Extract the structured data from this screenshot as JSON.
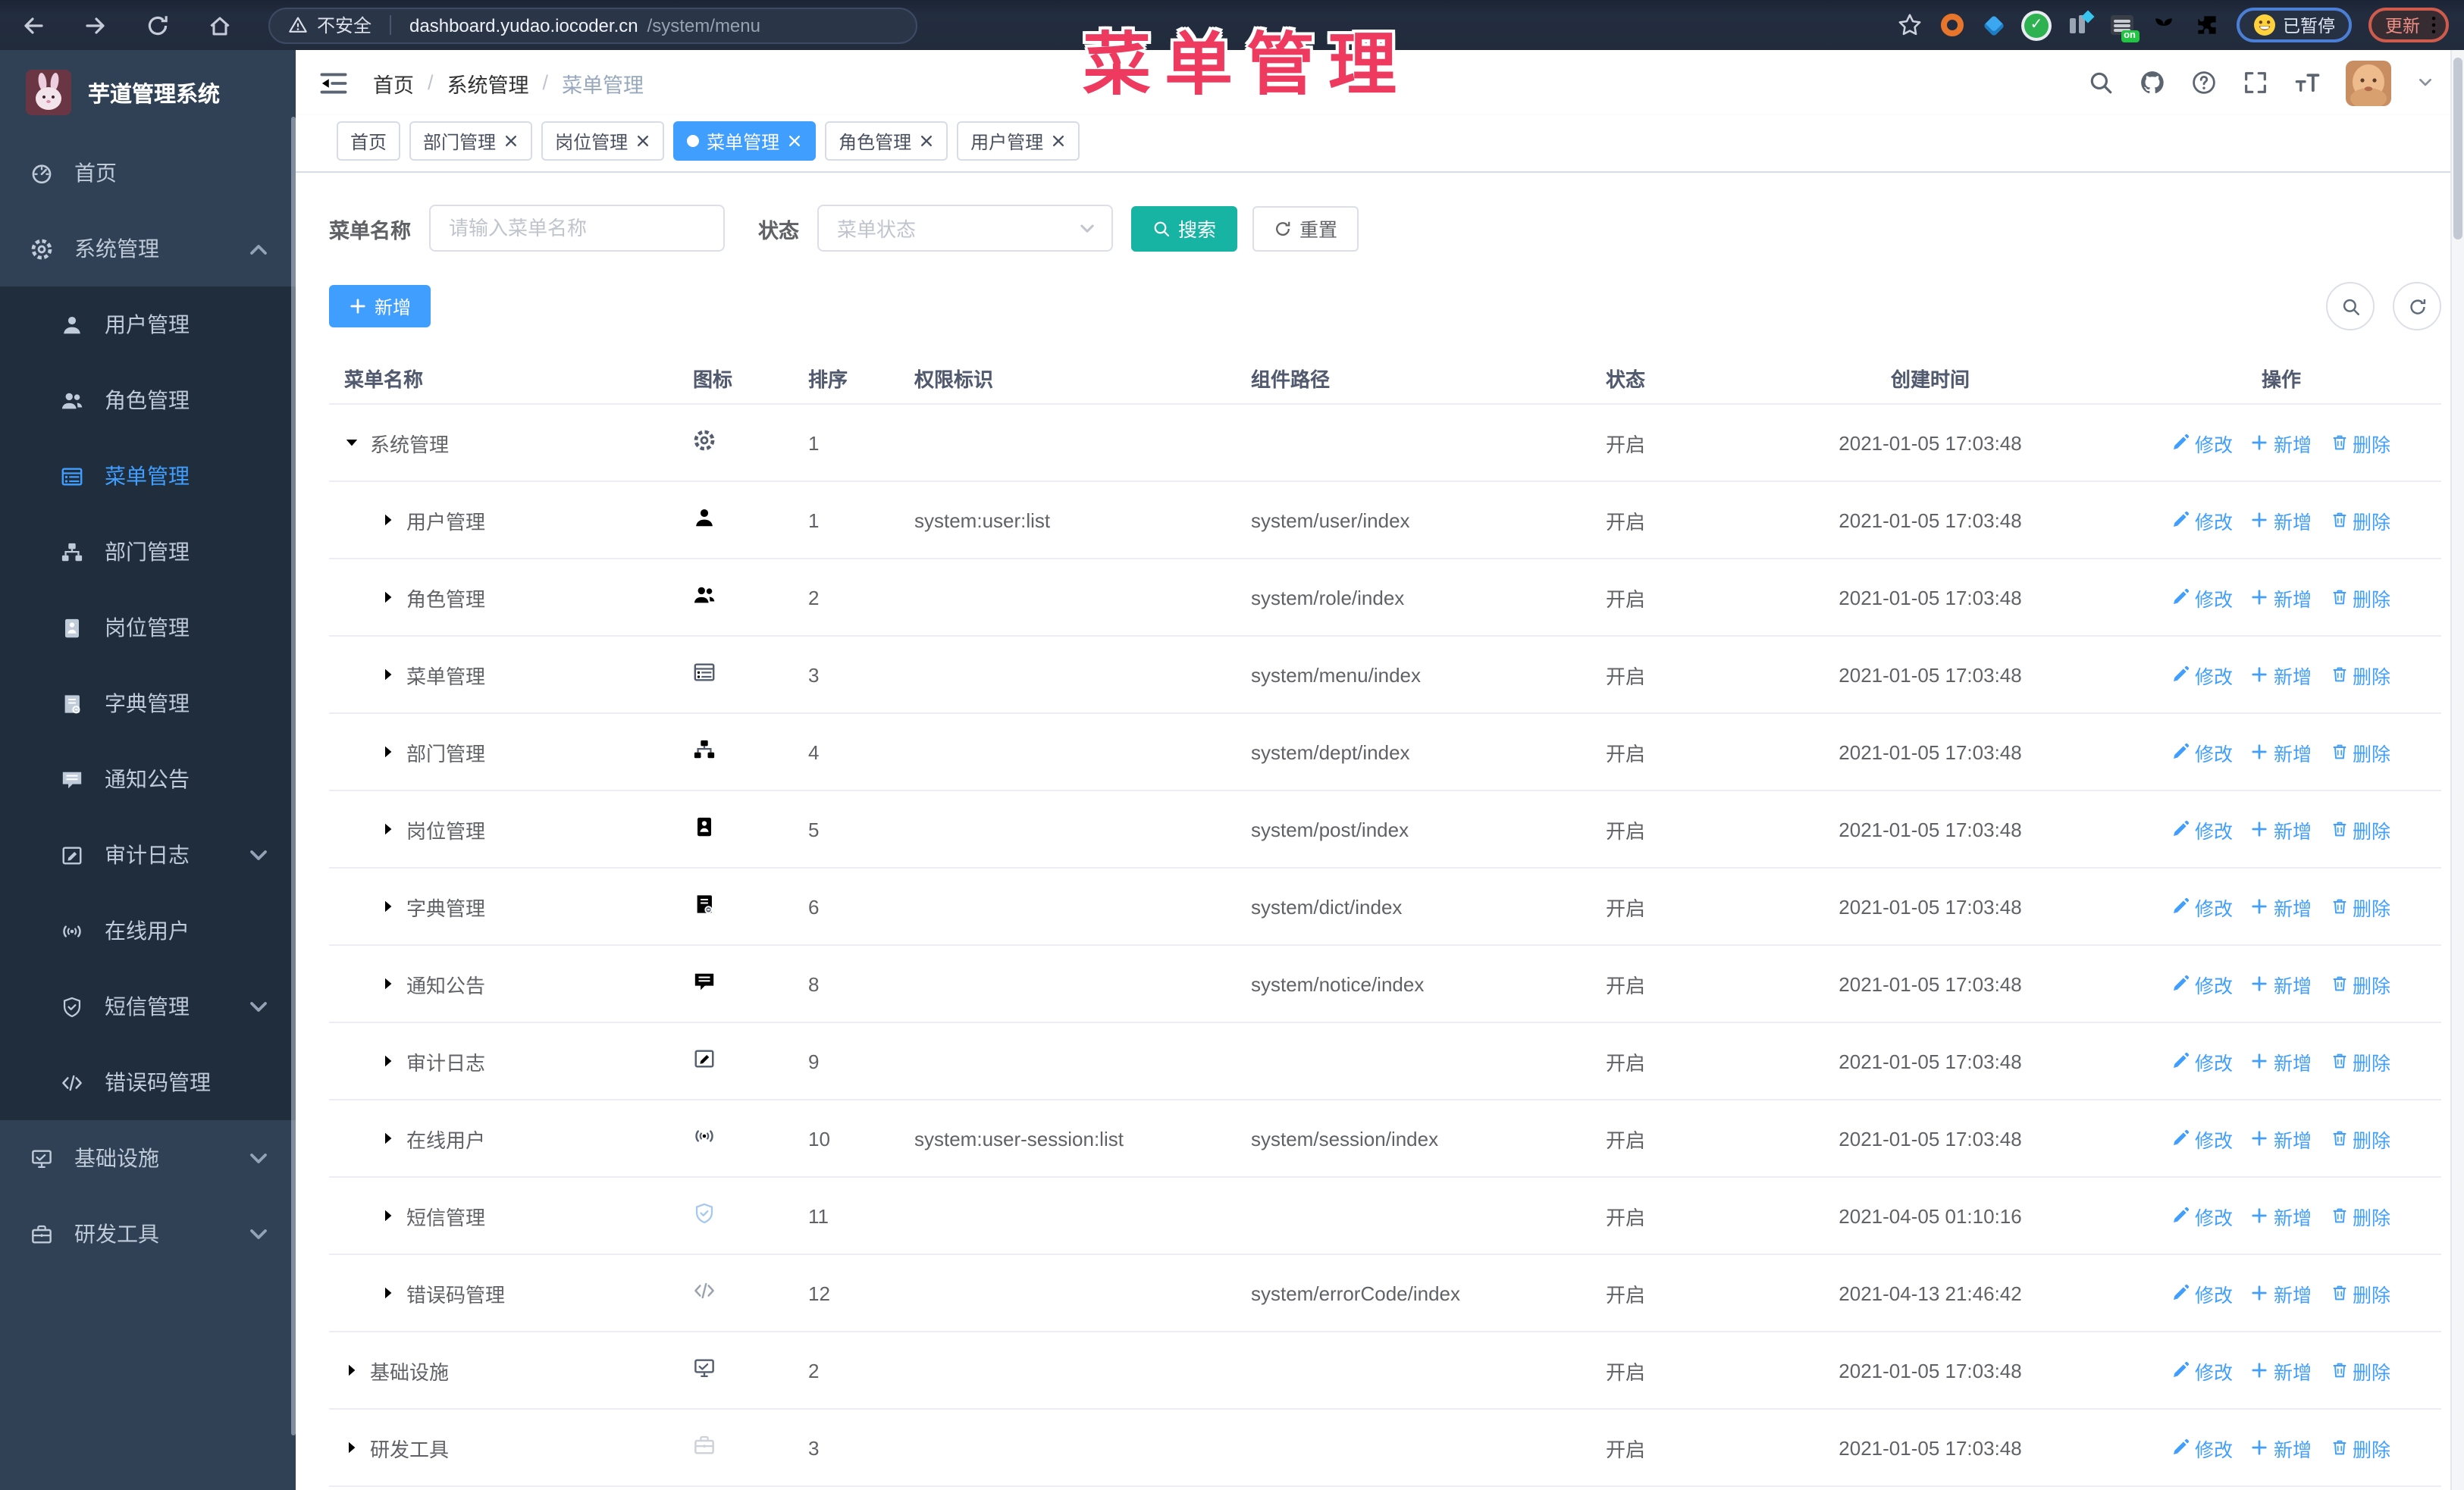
{
  "browser": {
    "security_label": "不安全",
    "url_host": "dashboard.yudao.iocoder.cn",
    "url_path": "/system/menu",
    "paused_badge": "已暂停",
    "update_button": "更新"
  },
  "overlay_title": "菜单管理",
  "header": {
    "breadcrumb": [
      "首页",
      "系统管理",
      "菜单管理"
    ]
  },
  "tabs": [
    {
      "label": "首页",
      "closable": false,
      "active": false
    },
    {
      "label": "部门管理",
      "closable": true,
      "active": false
    },
    {
      "label": "岗位管理",
      "closable": true,
      "active": false
    },
    {
      "label": "菜单管理",
      "closable": true,
      "active": true
    },
    {
      "label": "角色管理",
      "closable": true,
      "active": false
    },
    {
      "label": "用户管理",
      "closable": true,
      "active": false
    }
  ],
  "sidebar": {
    "logo_title": "芋道管理系统",
    "items": [
      {
        "label": "首页",
        "icon": "dash",
        "level": "top"
      },
      {
        "label": "系统管理",
        "icon": "gear",
        "level": "top",
        "arrow": "up",
        "open": true
      },
      {
        "label": "用户管理",
        "icon": "user",
        "level": "sub"
      },
      {
        "label": "角色管理",
        "icon": "users",
        "level": "sub"
      },
      {
        "label": "菜单管理",
        "icon": "menu",
        "level": "sub",
        "active": true
      },
      {
        "label": "部门管理",
        "icon": "tree",
        "level": "sub"
      },
      {
        "label": "岗位管理",
        "icon": "post",
        "level": "sub"
      },
      {
        "label": "字典管理",
        "icon": "dict",
        "level": "sub"
      },
      {
        "label": "通知公告",
        "icon": "msg",
        "level": "sub"
      },
      {
        "label": "审计日志",
        "icon": "form",
        "level": "sub",
        "arrow": "down"
      },
      {
        "label": "在线用户",
        "icon": "online",
        "level": "sub"
      },
      {
        "label": "短信管理",
        "icon": "shield",
        "level": "sub",
        "arrow": "down"
      },
      {
        "label": "错误码管理",
        "icon": "code",
        "level": "sub"
      },
      {
        "label": "基础设施",
        "icon": "monitor",
        "level": "top",
        "arrow": "down"
      },
      {
        "label": "研发工具",
        "icon": "tool",
        "level": "top",
        "arrow": "down"
      }
    ]
  },
  "filter": {
    "name_label": "菜单名称",
    "name_placeholder": "请输入菜单名称",
    "status_label": "状态",
    "status_placeholder": "菜单状态",
    "search_label": "搜索",
    "reset_label": "重置"
  },
  "toolbar": {
    "add_label": "新增"
  },
  "table": {
    "columns": [
      "菜单名称",
      "图标",
      "排序",
      "权限标识",
      "组件路径",
      "状态",
      "创建时间",
      "操作"
    ],
    "rows": [
      {
        "name": "系统管理",
        "icon": "gear",
        "sort": "1",
        "perm": "",
        "path": "",
        "status": "开启",
        "time": "2021-01-05 17:03:48",
        "level": 0,
        "expanded": true
      },
      {
        "name": "用户管理",
        "icon": "user",
        "sort": "1",
        "perm": "system:user:list",
        "path": "system/user/index",
        "status": "开启",
        "time": "2021-01-05 17:03:48",
        "level": 1
      },
      {
        "name": "角色管理",
        "icon": "users",
        "sort": "2",
        "perm": "",
        "path": "system/role/index",
        "status": "开启",
        "time": "2021-01-05 17:03:48",
        "level": 1
      },
      {
        "name": "菜单管理",
        "icon": "menu",
        "sort": "3",
        "perm": "",
        "path": "system/menu/index",
        "status": "开启",
        "time": "2021-01-05 17:03:48",
        "level": 1
      },
      {
        "name": "部门管理",
        "icon": "tree",
        "sort": "4",
        "perm": "",
        "path": "system/dept/index",
        "status": "开启",
        "time": "2021-01-05 17:03:48",
        "level": 1
      },
      {
        "name": "岗位管理",
        "icon": "post",
        "sort": "5",
        "perm": "",
        "path": "system/post/index",
        "status": "开启",
        "time": "2021-01-05 17:03:48",
        "level": 1
      },
      {
        "name": "字典管理",
        "icon": "dict",
        "sort": "6",
        "perm": "",
        "path": "system/dict/index",
        "status": "开启",
        "time": "2021-01-05 17:03:48",
        "level": 1
      },
      {
        "name": "通知公告",
        "icon": "msg",
        "sort": "8",
        "perm": "",
        "path": "system/notice/index",
        "status": "开启",
        "time": "2021-01-05 17:03:48",
        "level": 1
      },
      {
        "name": "审计日志",
        "icon": "form",
        "sort": "9",
        "perm": "",
        "path": "",
        "status": "开启",
        "time": "2021-01-05 17:03:48",
        "level": 1
      },
      {
        "name": "在线用户",
        "icon": "online",
        "sort": "10",
        "perm": "system:user-session:list",
        "path": "system/session/index",
        "status": "开启",
        "time": "2021-01-05 17:03:48",
        "level": 1
      },
      {
        "name": "短信管理",
        "icon": "shield",
        "sort": "11",
        "perm": "",
        "path": "",
        "status": "开启",
        "time": "2021-04-05 01:10:16",
        "level": 1
      },
      {
        "name": "错误码管理",
        "icon": "code",
        "sort": "12",
        "perm": "",
        "path": "system/errorCode/index",
        "status": "开启",
        "time": "2021-04-13 21:46:42",
        "level": 1
      },
      {
        "name": "基础设施",
        "icon": "monitor",
        "sort": "2",
        "perm": "",
        "path": "",
        "status": "开启",
        "time": "2021-01-05 17:03:48",
        "level": 0
      },
      {
        "name": "研发工具",
        "icon": "tool",
        "sort": "3",
        "perm": "",
        "path": "",
        "status": "开启",
        "time": "2021-01-05 17:03:48",
        "level": 0
      }
    ]
  },
  "row_actions": [
    "修改",
    "新增",
    "删除"
  ],
  "colors": {
    "accent": "#409eff",
    "search_button": "#17b3a3",
    "sidebar_bg": "#304156",
    "submenu_bg": "#1f2d3d",
    "annotation": "#ee3a5f",
    "tab_active": "#409eff"
  }
}
